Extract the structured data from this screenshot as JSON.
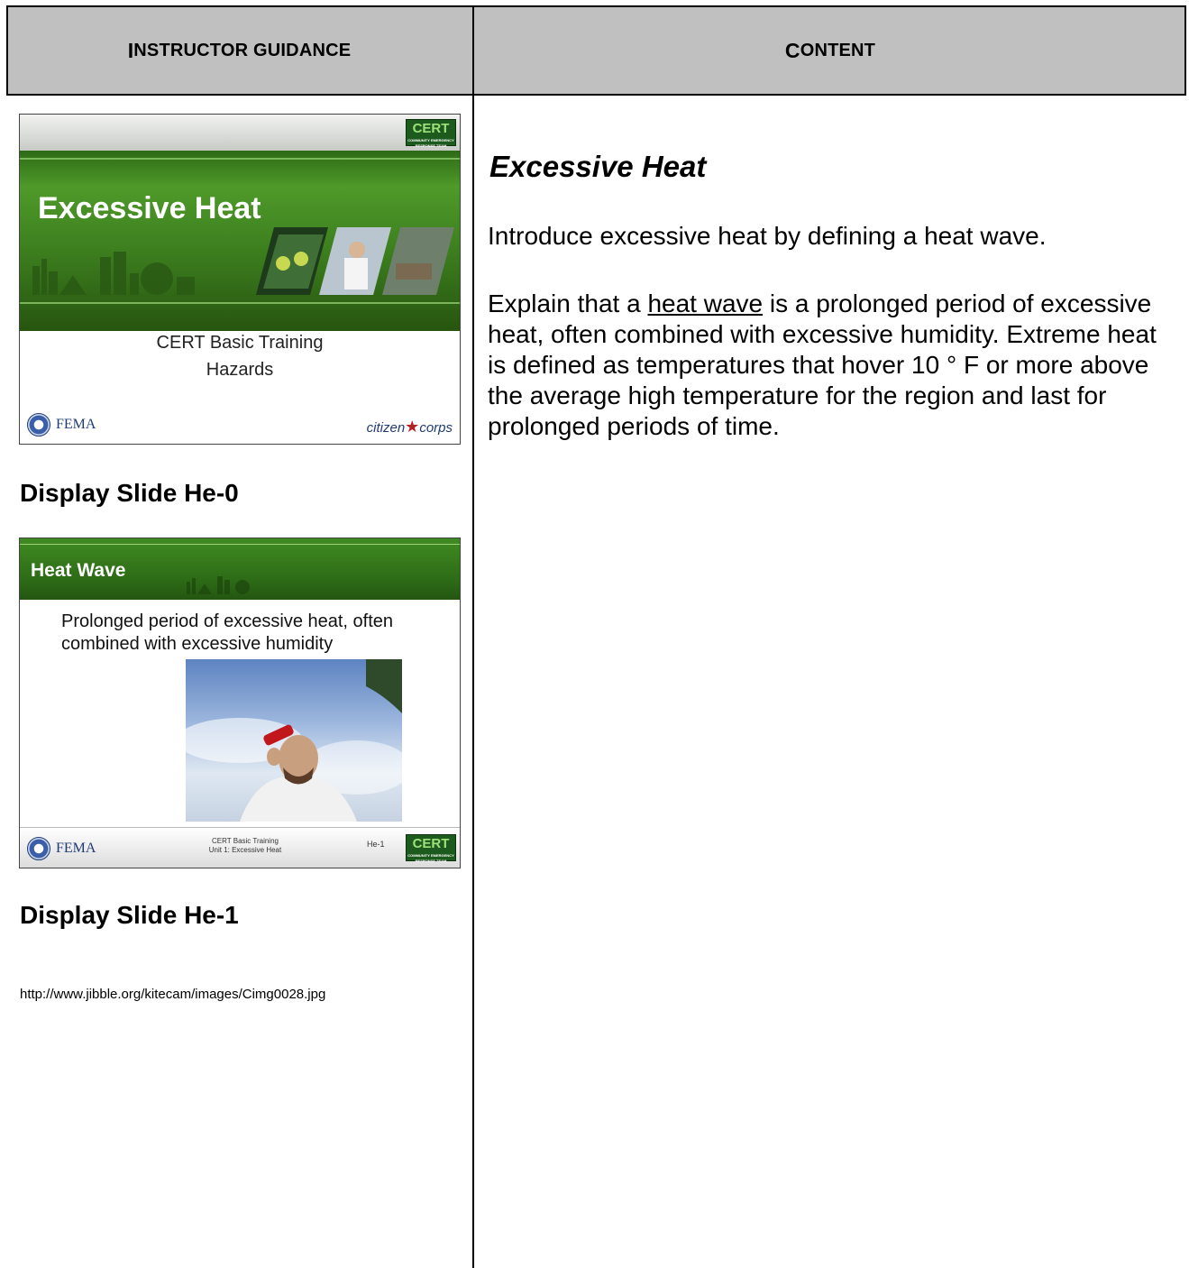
{
  "table_header": {
    "left_first": "I",
    "left_rest": "NSTRUCTOR GUIDANCE",
    "right_first": "C",
    "right_rest": "ONTENT"
  },
  "slide0": {
    "cert_logo": "CERT",
    "title": "Excessive Heat",
    "subtitle_line1": "CERT Basic Training",
    "subtitle_line2": "Hazards",
    "fema": "FEMA",
    "citizen_corps_a": "citizen",
    "citizen_corps_b": "corps",
    "caption": "Display Slide He-0"
  },
  "slide1": {
    "title": "Heat Wave",
    "body": "Prolonged period of excessive heat, often combined with excessive humidity",
    "fema": "FEMA",
    "footer_line1": "CERT Basic Training",
    "footer_line2": "Unit 1: Excessive Heat",
    "slide_number": "He-1",
    "cert_logo": "CERT",
    "caption": "Display Slide He-1"
  },
  "image_url": "http://www.jibble.org/kitecam/images/Cimg0028.jpg",
  "content": {
    "heading": "Excessive Heat",
    "para1": "Introduce excessive heat by defining a heat wave.",
    "para2_before": "Explain that a ",
    "para2_term": "heat wave",
    "para2_after": " is a prolonged period of excessive heat, often combined with excessive humidity.  Extreme heat is defined as temperatures that hover 10 ° F or more above the average high temperature for the region and last for prolonged periods of time."
  }
}
